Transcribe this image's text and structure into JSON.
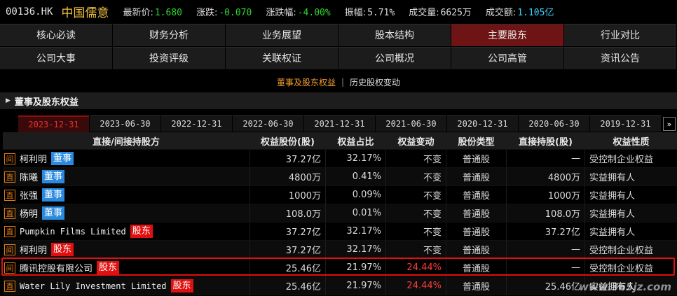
{
  "quote": {
    "code": "00136.HK",
    "name": "中国儒意",
    "items": [
      {
        "label": "最新价:",
        "value": "1.680",
        "color": "#2ed52e"
      },
      {
        "label": "涨跌:",
        "value": "-0.070",
        "color": "#2ed52e"
      },
      {
        "label": "涨跌幅:",
        "value": "-4.00%",
        "color": "#2ed52e"
      },
      {
        "label": "振幅:",
        "value": "5.71%",
        "color": "#dddddd"
      },
      {
        "label": "成交量:",
        "value": "6625万",
        "color": "#dddddd"
      },
      {
        "label": "成交额:",
        "value": "1.105亿",
        "color": "#3fd0ff"
      }
    ]
  },
  "nav": {
    "row1": [
      "核心必读",
      "财务分析",
      "业务展望",
      "股本结构",
      "主要股东",
      "行业对比"
    ],
    "row2": [
      "公司大事",
      "投资评级",
      "关联权证",
      "公司概况",
      "公司高管",
      "资讯公告"
    ],
    "active": "主要股东"
  },
  "subtabs": {
    "active": "董事及股东权益",
    "other": "历史股权变动"
  },
  "section": {
    "title": "董事及股东权益"
  },
  "dates": {
    "items": [
      "2023-12-31",
      "2023-06-30",
      "2022-12-31",
      "2022-06-30",
      "2021-12-31",
      "2021-06-30",
      "2020-12-31",
      "2020-06-30",
      "2019-12-31"
    ],
    "active_index": 0,
    "more": "»"
  },
  "table": {
    "headers": [
      "直接/间接持股方",
      "权益股份(股)",
      "权益占比",
      "权益变动",
      "股份类型",
      "直接持股(股)",
      "权益性质"
    ],
    "rows": [
      {
        "type": "间",
        "name": "柯利明",
        "role": "董事",
        "role_kind": "director",
        "shares": "37.27亿",
        "pct": "32.17%",
        "change": "不变",
        "class": "普通股",
        "direct": "—",
        "nature": "受控制企业权益"
      },
      {
        "type": "直",
        "name": "陈曦",
        "role": "董事",
        "role_kind": "director",
        "shares": "4800万",
        "pct": "0.41%",
        "change": "不变",
        "class": "普通股",
        "direct": "4800万",
        "nature": "实益拥有人"
      },
      {
        "type": "直",
        "name": "张强",
        "role": "董事",
        "role_kind": "director",
        "shares": "1000万",
        "pct": "0.09%",
        "change": "不变",
        "class": "普通股",
        "direct": "1000万",
        "nature": "实益拥有人"
      },
      {
        "type": "直",
        "name": "杨明",
        "role": "董事",
        "role_kind": "director",
        "shares": "108.0万",
        "pct": "0.01%",
        "change": "不变",
        "class": "普通股",
        "direct": "108.0万",
        "nature": "实益拥有人"
      },
      {
        "type": "直",
        "name": "Pumpkin Films Limited",
        "role": "股东",
        "role_kind": "holder",
        "shares": "37.27亿",
        "pct": "32.17%",
        "change": "不变",
        "class": "普通股",
        "direct": "37.27亿",
        "nature": "实益拥有人"
      },
      {
        "type": "间",
        "name": "柯利明",
        "role": "股东",
        "role_kind": "holder",
        "shares": "37.27亿",
        "pct": "32.17%",
        "change": "不变",
        "class": "普通股",
        "direct": "—",
        "nature": "受控制企业权益"
      },
      {
        "type": "间",
        "name": "腾讯控股有限公司",
        "role": "股东",
        "role_kind": "holder",
        "shares": "25.46亿",
        "pct": "21.97%",
        "change": "24.44%",
        "class": "普通股",
        "direct": "—",
        "nature": "受控制企业权益"
      },
      {
        "type": "直",
        "name": "Water Lily Investment Limited",
        "role": "股东",
        "role_kind": "holder",
        "shares": "25.46亿",
        "pct": "21.97%",
        "change": "24.44%",
        "class": "普通股",
        "direct": "25.46亿",
        "nature": "实益拥有人"
      }
    ]
  },
  "colors": {
    "accent_red": "#e01010",
    "director_blue": "#2a8ae0",
    "tab_orange": "#f2a030",
    "up_red": "#ff3b3b"
  },
  "watermark": "www.365jz.com"
}
